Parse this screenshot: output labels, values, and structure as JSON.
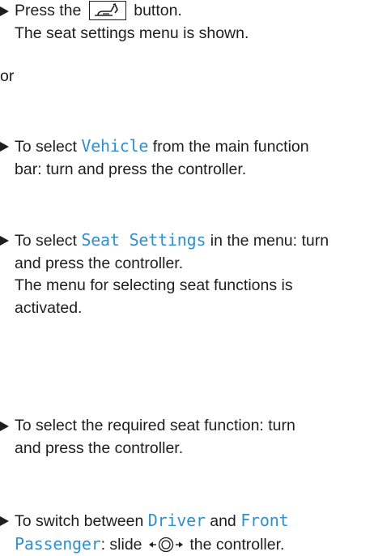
{
  "step1": {
    "text_before": "Press the",
    "icon": "seat-adjust-icon",
    "text_after": "button.",
    "result": "The seat settings menu is shown."
  },
  "or_label": "or",
  "step2": {
    "text_before": "To select",
    "highlight": "Vehicle",
    "text_after": "from the main function",
    "line2": "bar: turn and press the controller."
  },
  "step3": {
    "text_before": "To select",
    "highlight": "Seat Settings",
    "text_after": "in the menu: turn",
    "line2": "and press the controller.",
    "result_line1": "The menu for selecting seat functions is",
    "result_line2": "activated."
  },
  "step4": {
    "line1": "To select the required seat function: turn",
    "line2": "and press the controller."
  },
  "step5": {
    "text_before": "To switch between",
    "highlight1": "Driver",
    "text_and": "and",
    "highlight2": "Front",
    "highlight2b": "Passenger",
    "text_colon": ":",
    "text_slide": "slide",
    "icon": "controller-slide-left-right-icon",
    "text_end": "the controller."
  },
  "colors": {
    "text": "#1e1e1e",
    "highlight": "#2f8fcf"
  }
}
